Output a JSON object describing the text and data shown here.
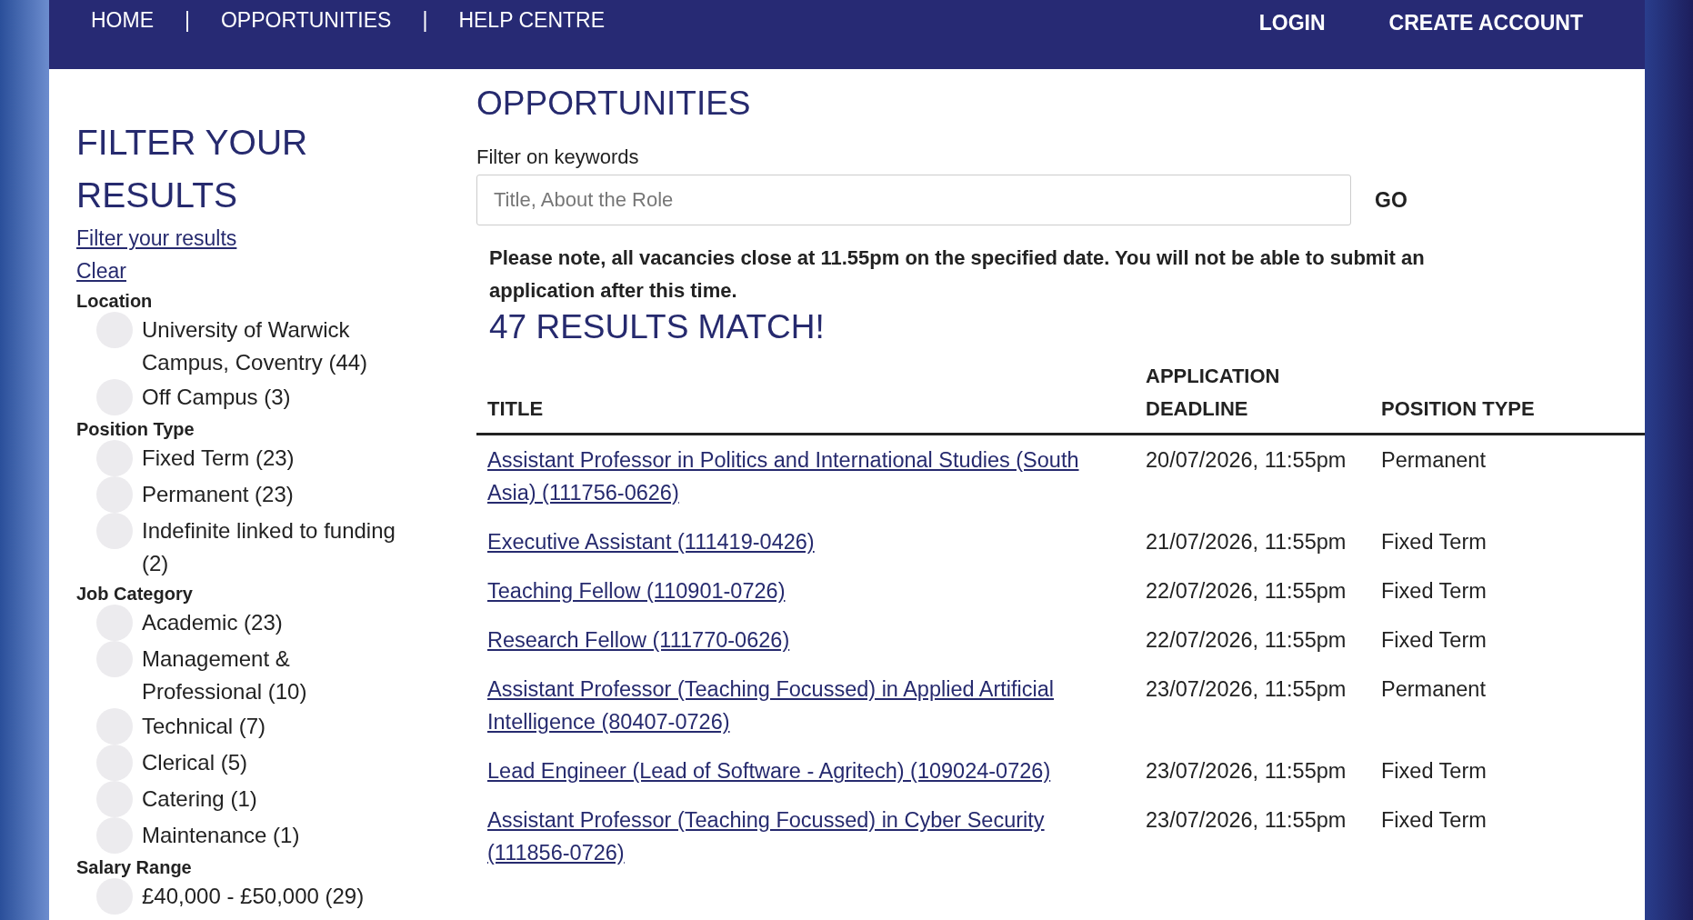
{
  "nav": {
    "links": [
      "HOME",
      "OPPORTUNITIES",
      "HELP CENTRE"
    ],
    "separator": "|",
    "account": [
      "LOGIN",
      "CREATE ACCOUNT"
    ]
  },
  "sidebar": {
    "title": "FILTER YOUR RESULTS",
    "links": [
      "Filter your results",
      "Clear"
    ],
    "groups": [
      {
        "label": "Location",
        "options": [
          {
            "label": "University of Warwick Campus, Coventry (44)",
            "selected": false
          },
          {
            "label": "Off Campus (3)",
            "selected": false
          }
        ]
      },
      {
        "label": "Position Type",
        "options": [
          {
            "label": "Fixed Term (23)",
            "selected": false
          },
          {
            "label": "Permanent (23)",
            "selected": false
          },
          {
            "label": "Indefinite linked to funding (2)",
            "selected": false
          }
        ]
      },
      {
        "label": "Job Category",
        "options": [
          {
            "label": "Academic (23)",
            "selected": false
          },
          {
            "label": "Management & Professional (10)",
            "selected": false
          },
          {
            "label": "Technical (7)",
            "selected": false
          },
          {
            "label": "Clerical (5)",
            "selected": false
          },
          {
            "label": "Catering (1)",
            "selected": false
          },
          {
            "label": "Maintenance (1)",
            "selected": false
          }
        ]
      },
      {
        "label": "Salary Range",
        "options": [
          {
            "label": "£40,000 - £50,000 (29)",
            "selected": false
          }
        ]
      }
    ]
  },
  "main": {
    "title": "OPPORTUNITIES",
    "search": {
      "label": "Filter on keywords",
      "placeholder": "Title, About the Role",
      "button": "GO"
    },
    "note": "Please note, all vacancies close at 11.55pm on the specified date.  You will not be able to submit an application after this time.",
    "results": "47 RESULTS MATCH!",
    "table": {
      "columns": [
        "TITLE",
        "APPLICATION DEADLINE",
        "POSITION TYPE"
      ],
      "rows": [
        {
          "title": "Assistant Professor in Politics and International Studies (South Asia) (111756-0626)",
          "deadline": "20/07/2026, 11:55pm",
          "type": "Permanent"
        },
        {
          "title": "Executive Assistant (111419-0426)",
          "deadline": "21/07/2026, 11:55pm",
          "type": "Fixed Term"
        },
        {
          "title": "Teaching Fellow (110901-0726)",
          "deadline": "22/07/2026, 11:55pm",
          "type": "Fixed Term"
        },
        {
          "title": "Research Fellow (111770-0626)",
          "deadline": "22/07/2026, 11:55pm",
          "type": "Fixed Term"
        },
        {
          "title": "Assistant Professor (Teaching Focussed) in Applied Artificial Intelligence (80407-0726)",
          "deadline": "23/07/2026, 11:55pm",
          "type": "Permanent"
        },
        {
          "title": "Lead Engineer (Lead of Software - Agritech) (109024-0726)",
          "deadline": "23/07/2026, 11:55pm",
          "type": "Fixed Term"
        },
        {
          "title": "Assistant Professor (Teaching Focussed) in Cyber Security (111856-0726)",
          "deadline": "23/07/2026, 11:55pm",
          "type": "Fixed Term"
        }
      ]
    }
  }
}
